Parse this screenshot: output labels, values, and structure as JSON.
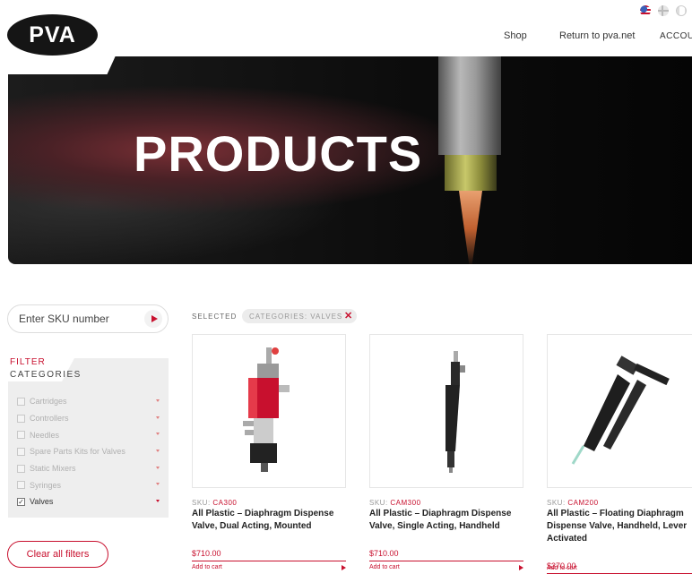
{
  "header": {
    "logo_text": "PVA",
    "languages": [
      "us-flag-icon",
      "no-flag-icon",
      "ca-flag-icon"
    ],
    "nav": [
      {
        "label": "Shop"
      },
      {
        "label": "Return to pva.net"
      },
      {
        "label": "ACCOUNT"
      }
    ]
  },
  "hero": {
    "title": "PRODUCTS"
  },
  "sidebar": {
    "sku_placeholder": "Enter SKU number",
    "filter_label": "FILTER",
    "categories_label": "CATEGORIES",
    "categories": [
      {
        "label": "Cartridges",
        "checked": false
      },
      {
        "label": "Controllers",
        "checked": false
      },
      {
        "label": "Needles",
        "checked": false
      },
      {
        "label": "Spare Parts Kits for Valves",
        "checked": false
      },
      {
        "label": "Static Mixers",
        "checked": false
      },
      {
        "label": "Syringes",
        "checked": false
      },
      {
        "label": "Valves",
        "checked": true
      }
    ],
    "clear_label": "Clear all filters"
  },
  "selected": {
    "label": "SELECTED",
    "chip": "CATEGORIES: VALVES",
    "chip_remove": "✕"
  },
  "products": [
    {
      "sku_prefix": "SKU: ",
      "sku": "CA300",
      "name": "All Plastic – Diaphragm Dispense Valve, Dual Acting, Mounted",
      "price": "$710.00",
      "cta": "Add to cart"
    },
    {
      "sku_prefix": "SKU: ",
      "sku": "CAM300",
      "name": "All Plastic – Diaphragm Dispense Valve, Single Acting, Handheld",
      "price": "$710.00",
      "cta": "Add to cart"
    },
    {
      "sku_prefix": "SKU: ",
      "sku": "CAM200",
      "name": "All Plastic – Floating Diaphragm Dispense Valve, Handheld, Lever Activated",
      "price": "$370.00",
      "cta": "Add to cart"
    }
  ],
  "colors": {
    "accent": "#c8102e",
    "panel": "#eeeeee",
    "text": "#222222"
  }
}
